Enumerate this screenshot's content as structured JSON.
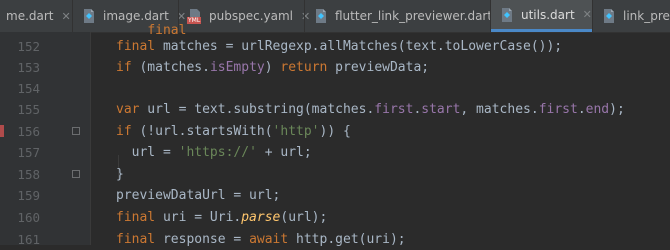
{
  "tabs": [
    {
      "label": "me.dart",
      "icon": "dart-file-icon",
      "active": false
    },
    {
      "label": "image.dart",
      "icon": "dart-file-icon",
      "active": false
    },
    {
      "label": "pubspec.yaml",
      "icon": "yaml-file-icon",
      "active": false
    },
    {
      "label": "flutter_link_previewer.dart",
      "icon": "dart-file-icon",
      "active": false
    },
    {
      "label": "utils.dart",
      "icon": "dart-file-icon",
      "active": true
    },
    {
      "label": "link_previe",
      "icon": "dart-file-icon",
      "active": false
    }
  ],
  "yaml_badge": "YML",
  "close_glyph": "✕",
  "colors": {
    "keyword": "#cc7832",
    "field": "#9876aa",
    "string": "#6a8759",
    "function": "#ffc66d",
    "plain": "#a9b7c6",
    "active_tab_underline": "#4a88c7"
  },
  "lines": [
    {
      "number": "",
      "tokens": [
        [
          "pl",
          "    "
        ],
        [
          "kw",
          "final"
        ],
        [
          "pl",
          " "
        ]
      ]
    },
    {
      "number": "152",
      "tokens": [
        [
          "kw",
          "final"
        ],
        [
          "pl",
          " matches = urlRegexp.allMatches(text.toLowerCase());"
        ]
      ]
    },
    {
      "number": "153",
      "tokens": [
        [
          "kw",
          "if"
        ],
        [
          "pl",
          " (matches."
        ],
        [
          "fld",
          "isEmpty"
        ],
        [
          "pl",
          ") "
        ],
        [
          "kw",
          "return"
        ],
        [
          "pl",
          " previewData;"
        ]
      ]
    },
    {
      "number": "154",
      "tokens": []
    },
    {
      "number": "155",
      "tokens": [
        [
          "kw",
          "var"
        ],
        [
          "pl",
          " url = text.substring(matches."
        ],
        [
          "fld",
          "first"
        ],
        [
          "pl",
          "."
        ],
        [
          "fld",
          "start"
        ],
        [
          "pl",
          ", matches."
        ],
        [
          "fld",
          "first"
        ],
        [
          "pl",
          "."
        ],
        [
          "fld",
          "end"
        ],
        [
          "pl",
          ");"
        ]
      ]
    },
    {
      "number": "156",
      "tokens": [
        [
          "kw",
          "if"
        ],
        [
          "pl",
          " (!url.startsWith("
        ],
        [
          "str",
          "'http'"
        ],
        [
          "pl",
          ")) {"
        ]
      ]
    },
    {
      "number": "157",
      "tokens": [
        [
          "pl",
          "  url = "
        ],
        [
          "str",
          "'https://'"
        ],
        [
          "pl",
          " + url;"
        ]
      ]
    },
    {
      "number": "158",
      "tokens": [
        [
          "pl",
          "}"
        ]
      ]
    },
    {
      "number": "159",
      "tokens": [
        [
          "pl",
          "previewDataUrl = url;"
        ]
      ]
    },
    {
      "number": "160",
      "tokens": [
        [
          "kw",
          "final"
        ],
        [
          "pl",
          " uri = Uri."
        ],
        [
          "fn",
          "parse"
        ],
        [
          "pl",
          "(url);"
        ]
      ]
    },
    {
      "number": "161",
      "tokens": [
        [
          "kw",
          "final"
        ],
        [
          "pl",
          " response = "
        ],
        [
          "kw",
          "await"
        ],
        [
          "pl",
          " http.get(uri);"
        ]
      ]
    }
  ]
}
